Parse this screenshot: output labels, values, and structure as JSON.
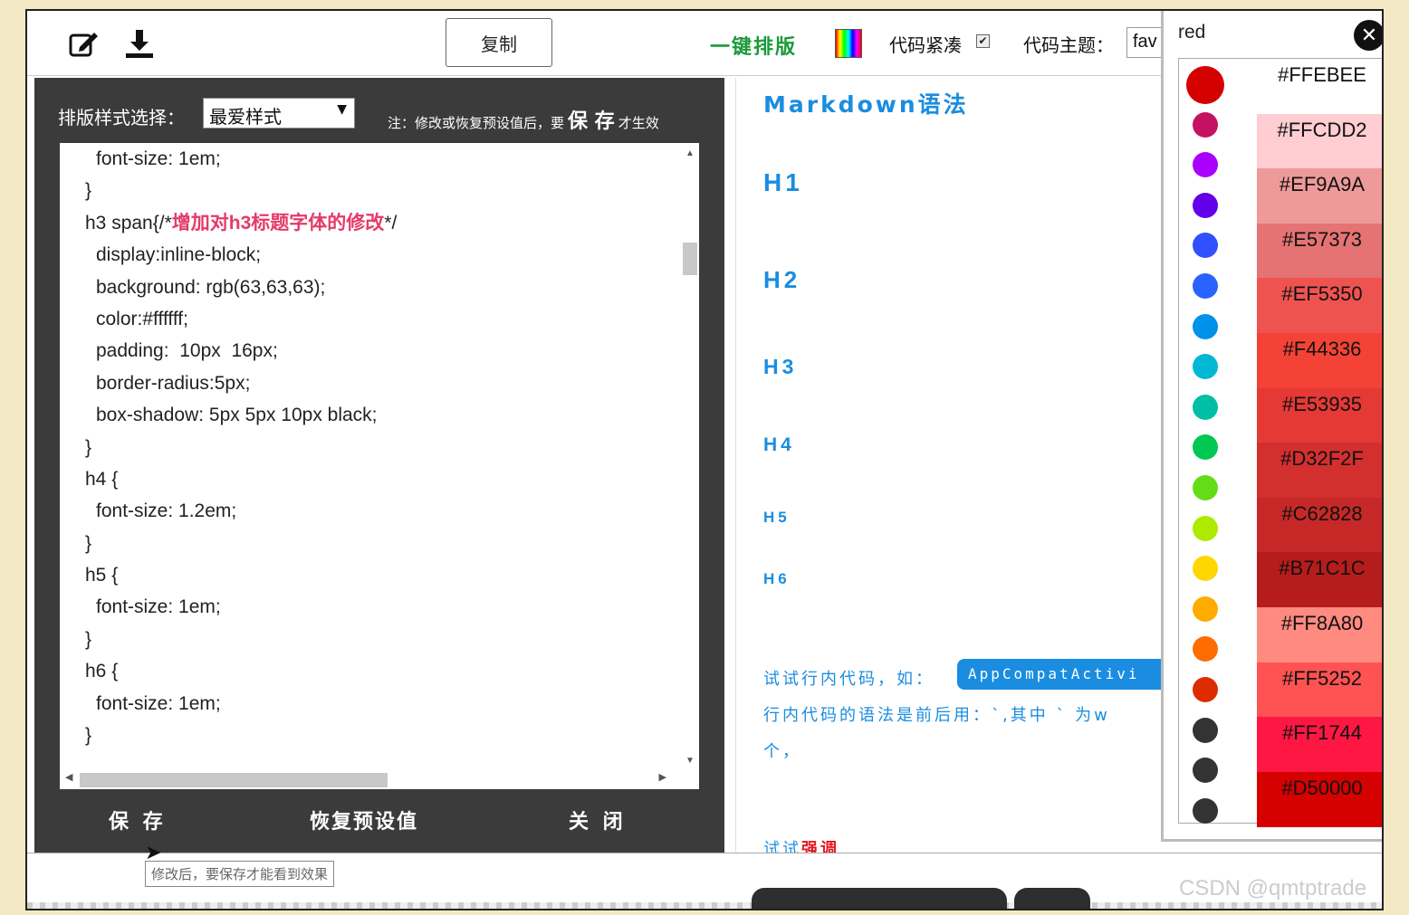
{
  "toolbar": {
    "copy_label": "复制",
    "one_click_label": "一键排版",
    "compact_label": "代码紧凑",
    "theme_label": "代码主题：",
    "theme_value": "fav"
  },
  "editor": {
    "style_label": "排版样式选择：",
    "style_value": "最爱样式",
    "note_prefix": "注：修改或恢复预设值后，要",
    "note_bold": "保 存",
    "note_suffix": "才生效",
    "code_lines": [
      {
        "text": "font-size: 1em;",
        "indent": true
      },
      {
        "text": "}",
        "indent": false
      },
      {
        "text": "h3 span{/*",
        "indent": false,
        "comment": "增加对h3标题字体的修改",
        "tail": "*/"
      },
      {
        "text": "display:inline-block;",
        "indent": true
      },
      {
        "text": "background: rgb(63,63,63);",
        "indent": true
      },
      {
        "text": "color:#ffffff;",
        "indent": true
      },
      {
        "text": "padding:  10px  16px;",
        "indent": true
      },
      {
        "text": "border-radius:5px;",
        "indent": true
      },
      {
        "text": "box-shadow: 5px 5px 10px black;",
        "indent": true
      },
      {
        "text": "}",
        "indent": false
      },
      {
        "text": "h4 {",
        "indent": false
      },
      {
        "text": "font-size: 1.2em;",
        "indent": true
      },
      {
        "text": "}",
        "indent": false
      },
      {
        "text": "h5 {",
        "indent": false
      },
      {
        "text": "font-size: 1em;",
        "indent": true
      },
      {
        "text": "}",
        "indent": false
      },
      {
        "text": "h6 {",
        "indent": false
      },
      {
        "text": "font-size: 1em;",
        "indent": true
      },
      {
        "text": "}",
        "indent": false
      }
    ],
    "save_label": "保 存",
    "restore_label": "恢复预设值",
    "close_label": "关 闭"
  },
  "preview": {
    "title": "Markdown语法",
    "h1": "H1",
    "h2": "H2",
    "h3": "H3",
    "h4": "H4",
    "h5": "H5",
    "h6": "H6",
    "inline_try": "试试行内代码，如：",
    "inline_code": "AppCompatActivi",
    "inline_syntax": "行内代码的语法是前后用：`,其中 ` 为w",
    "inline_tail": "个，",
    "emphasis_prefix": "试试",
    "emphasis_word": "强调"
  },
  "picker": {
    "name": "red",
    "colors": [
      {
        "dot": "#D50000",
        "hex": "#FFEBEE",
        "bg": "#FFFFFF"
      },
      {
        "dot": "#C51162",
        "hex": "#FFCDD2",
        "bg": "#FFCDD2"
      },
      {
        "dot": "#AA00FF",
        "hex": "#EF9A9A",
        "bg": "#EF9A9A"
      },
      {
        "dot": "#6200EA",
        "hex": "#E57373",
        "bg": "#E57373"
      },
      {
        "dot": "#304FFE",
        "hex": "#EF5350",
        "bg": "#EF5350"
      },
      {
        "dot": "#2962FF",
        "hex": "#F44336",
        "bg": "#F44336"
      },
      {
        "dot": "#0091EA",
        "hex": "#E53935",
        "bg": "#E53935"
      },
      {
        "dot": "#00B8D4",
        "hex": "#D32F2F",
        "bg": "#D32F2F"
      },
      {
        "dot": "#00BFA5",
        "hex": "#C62828",
        "bg": "#C62828"
      },
      {
        "dot": "#00C853",
        "hex": "#B71C1C",
        "bg": "#B71C1C"
      },
      {
        "dot": "#64DD17",
        "hex": "#FF8A80",
        "bg": "#FF8A80"
      },
      {
        "dot": "#AEEA00",
        "hex": "#FF5252",
        "bg": "#FF5252"
      },
      {
        "dot": "#FFD600",
        "hex": "#FF1744",
        "bg": "#FF1744"
      },
      {
        "dot": "#FFAB00",
        "hex": "#D50000",
        "bg": "#D50000"
      },
      {
        "dot": "#FF6D00",
        "hex": "",
        "bg": ""
      },
      {
        "dot": "#DD2C00",
        "hex": "",
        "bg": ""
      },
      {
        "dot": "#333333",
        "hex": "",
        "bg": ""
      },
      {
        "dot": "#333333",
        "hex": "",
        "bg": ""
      },
      {
        "dot": "#333333",
        "hex": "",
        "bg": ""
      }
    ]
  },
  "status": {
    "tooltip": "修改后，要保存才能看到效果"
  },
  "watermark": "CSDN @qmtptrade"
}
